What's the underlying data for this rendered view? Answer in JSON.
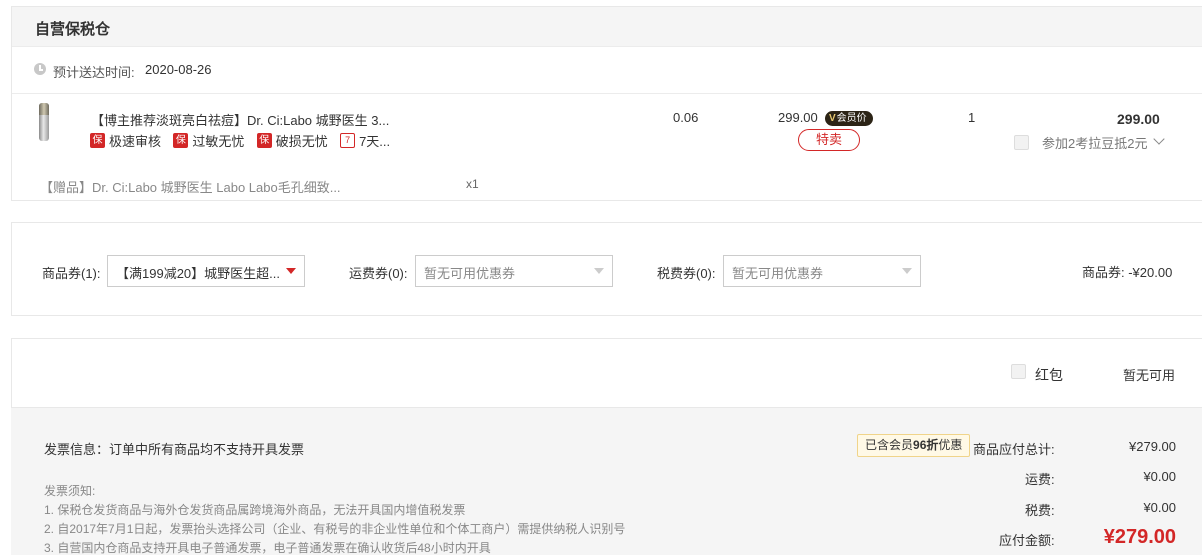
{
  "warehouse": {
    "title": "自营保税仓",
    "delivery_label": "预计送达时间:",
    "delivery_date": "2020-08-26"
  },
  "product": {
    "name": "【博主推荐淡斑亮白祛痘】Dr. Ci:Labo 城野医生 3...",
    "tags": [
      {
        "icon": "保",
        "label": "极速审核"
      },
      {
        "icon": "保",
        "label": "过敏无忧"
      },
      {
        "icon": "保",
        "label": "破损无忧"
      },
      {
        "icon": "7",
        "label": "7天..."
      }
    ],
    "tax": "0.06",
    "price": "299.00",
    "member_badge": "会员价",
    "member_badge_mark": "V",
    "special_label": "特卖",
    "quantity": "1",
    "subtotal": "299.00",
    "koala_text": "参加2考拉豆抵2元",
    "gift": "【赠品】Dr. Ci:Labo 城野医生 Labo Labo毛孔细致...",
    "gift_qty": "x1"
  },
  "coupons": {
    "goods_label": "商品券(1):",
    "goods_value": "【满199减20】城野医生超...",
    "shipping_label": "运费券(0):",
    "shipping_value": "暂无可用优惠券",
    "tax_label": "税费券(0):",
    "tax_value": "暂无可用优惠券",
    "goods_summary": "商品券: -¥20.00"
  },
  "redpack": {
    "label": "红包",
    "status": "暂无可用"
  },
  "invoice": {
    "info": "发票信息：订单中所有商品均不支持开具发票",
    "notice_title": "发票须知:",
    "notices": [
      "1. 保税仓发货商品与海外仓发货商品属跨境海外商品，无法开具国内增值税发票",
      "2. 自2017年7月1日起，发票抬头选择公司（企业、有税号的非企业性单位和个体工商户）需提供纳税人识别号",
      "3. 自营国内仓商品支持开具电子普通发票，电子普通发票在确认收货后48小时内开具"
    ]
  },
  "summary": {
    "vip_prefix": "已含会员",
    "vip_discount": "96折",
    "vip_suffix": "优惠",
    "goods_total_label": "商品应付总计:",
    "goods_total": "¥279.00",
    "shipping_label": "运费:",
    "shipping": "¥0.00",
    "tax_label": "税费:",
    "tax": "¥0.00",
    "payable_label": "应付金额:",
    "payable": "¥279.00"
  },
  "colors": {
    "accent_red": "#d32727",
    "vip_gold": "#e8c870",
    "panel_gray": "#f5f5f5"
  }
}
